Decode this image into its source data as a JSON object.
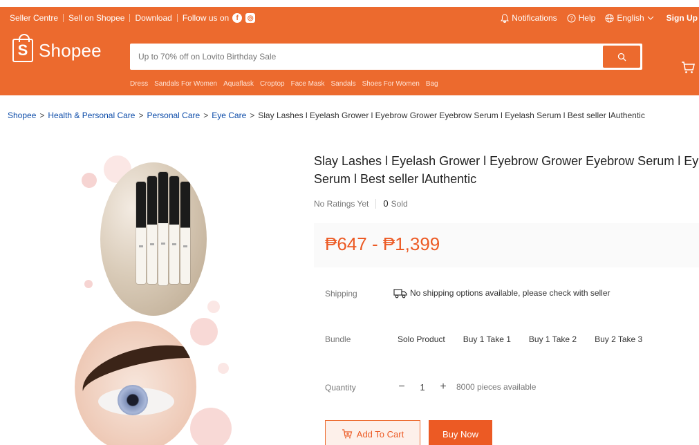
{
  "topbar": {
    "seller_centre": "Seller Centre",
    "sell_on_shopee": "Sell on Shopee",
    "download": "Download",
    "follow_us": "Follow us on",
    "notifications": "Notifications",
    "help": "Help",
    "language": "English",
    "sign_up": "Sign Up"
  },
  "brand": {
    "name": "Shopee",
    "letter": "S"
  },
  "search": {
    "placeholder": "Up to 70% off on Lovito Birthday Sale"
  },
  "keywords": [
    "Dress",
    "Sandals For Women",
    "Aquaflask",
    "Croptop",
    "Face Mask",
    "Sandals",
    "Shoes For Women",
    "Bag"
  ],
  "breadcrumb": {
    "items": [
      "Shopee",
      "Health & Personal Care",
      "Personal Care",
      "Eye Care"
    ],
    "separator": ">",
    "current": "Slay Lashes l Eyelash Grower l Eyebrow Grower Eyebrow Serum l Eyelash Serum l Best seller lAuthentic"
  },
  "product": {
    "title_line1": "Slay Lashes l Eyelash Grower l Eyebrow Grower Eyebrow Serum l Eyelas",
    "title_line2": "Serum l Best seller lAuthentic",
    "ratings": "No Ratings Yet",
    "sold_count": "0",
    "sold_label": "Sold",
    "price": "₱647 - ₱1,399"
  },
  "shipping": {
    "label": "Shipping",
    "value": "No shipping options available, please check with seller"
  },
  "bundle": {
    "label": "Bundle",
    "options": [
      "Solo Product",
      "Buy 1 Take 1",
      "Buy 1 Take 2",
      "Buy 2 Take 3"
    ]
  },
  "quantity": {
    "label": "Quantity",
    "minus": "−",
    "value": "1",
    "plus": "+",
    "available": "8000 pieces available"
  },
  "actions": {
    "add_to_cart": "Add To Cart",
    "buy_now": "Buy Now"
  },
  "colors": {
    "brand": "#ec6a2e",
    "price": "#ec5a24",
    "link": "#0a4aa8"
  }
}
